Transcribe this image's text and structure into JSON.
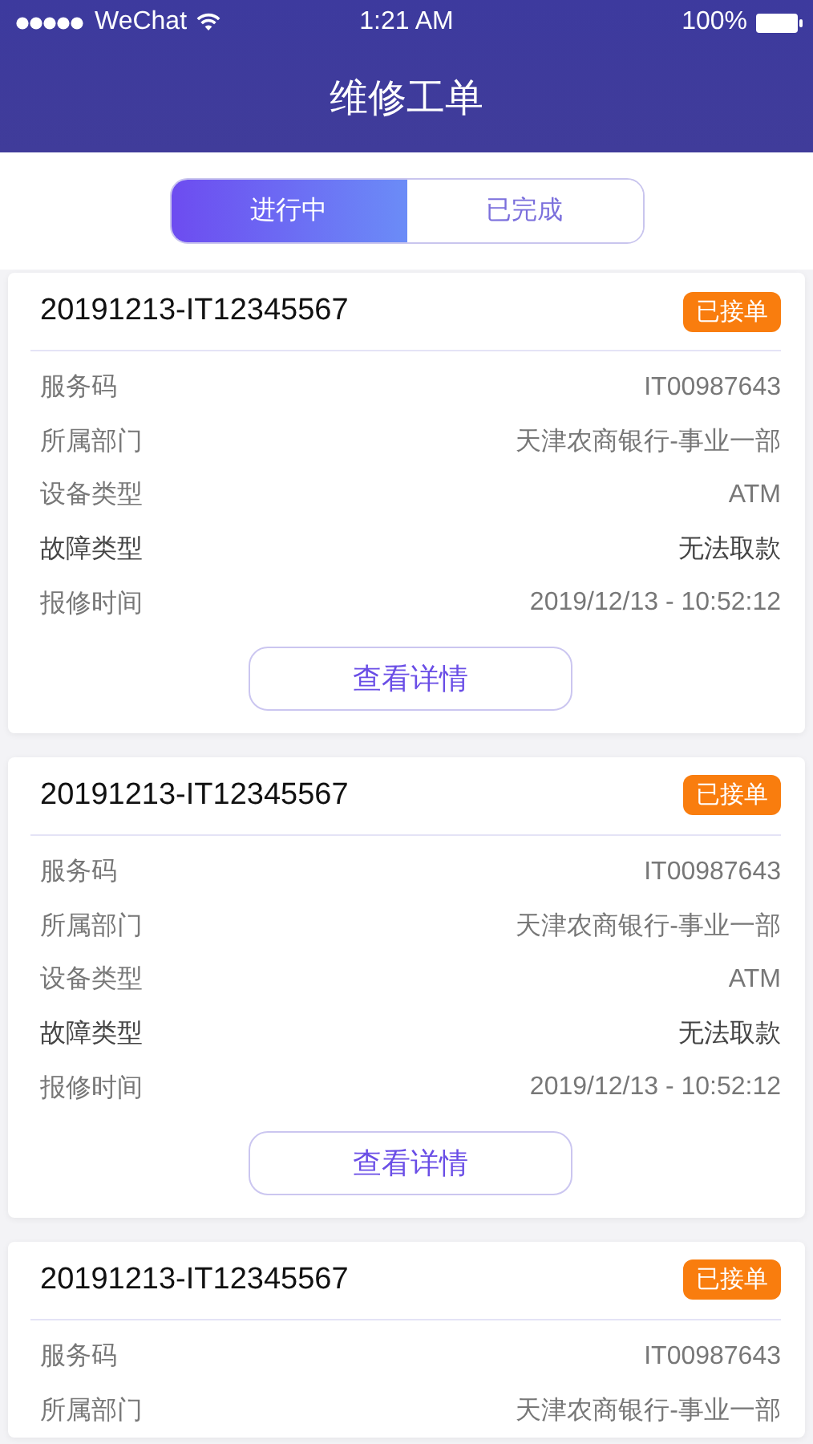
{
  "status_bar": {
    "carrier": "WeChat",
    "time": "1:21 AM",
    "battery": "100%"
  },
  "nav": {
    "title": "维修工单"
  },
  "tabs": [
    {
      "label": "进行中",
      "selected": true
    },
    {
      "label": "已完成",
      "selected": false
    }
  ],
  "orders": [
    {
      "number": "20191213-IT12345567",
      "status": "已接单",
      "rows": [
        {
          "label": "服务码",
          "value": "IT00987643",
          "emphasis": false
        },
        {
          "label": "所属部门",
          "value": "天津农商银行-事业一部",
          "emphasis": false
        },
        {
          "label": "设备类型",
          "value": "ATM",
          "emphasis": false
        },
        {
          "label": "故障类型",
          "value": "无法取款",
          "emphasis": true
        },
        {
          "label": "报修时间",
          "value": "2019/12/13 - 10:52:12",
          "emphasis": false
        }
      ],
      "button": "查看详情"
    },
    {
      "number": "20191213-IT12345567",
      "status": "已接单",
      "rows": [
        {
          "label": "服务码",
          "value": "IT00987643",
          "emphasis": false
        },
        {
          "label": "所属部门",
          "value": "天津农商银行-事业一部",
          "emphasis": false
        },
        {
          "label": "设备类型",
          "value": "ATM",
          "emphasis": false
        },
        {
          "label": "故障类型",
          "value": "无法取款",
          "emphasis": true
        },
        {
          "label": "报修时间",
          "value": "2019/12/13 - 10:52:12",
          "emphasis": false
        }
      ],
      "button": "查看详情"
    },
    {
      "number": "20191213-IT12345567",
      "status": "已接单",
      "rows": [
        {
          "label": "服务码",
          "value": "IT00987643",
          "emphasis": false
        },
        {
          "label": "所属部门",
          "value": "天津农商银行-事业一部",
          "emphasis": false
        }
      ]
    }
  ]
}
